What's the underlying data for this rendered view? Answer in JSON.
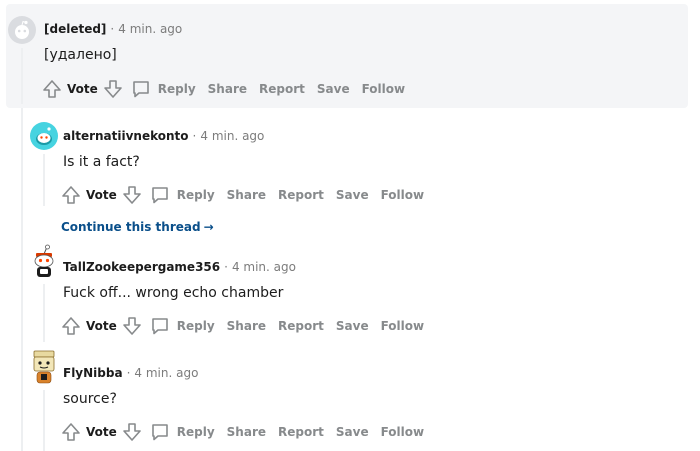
{
  "comments": [
    {
      "author": "[deleted]",
      "time": "4 min. ago",
      "body": "[удалено]",
      "actions": {
        "vote": "Vote",
        "reply": "Reply",
        "share": "Share",
        "report": "Report",
        "save": "Save",
        "follow": "Follow"
      },
      "avatar_icon": "deleted-user-avatar"
    },
    {
      "author": "alternatiivnekonto",
      "time": "4 min. ago",
      "body": "Is it a fact?",
      "actions": {
        "vote": "Vote",
        "reply": "Reply",
        "share": "Share",
        "report": "Report",
        "save": "Save",
        "follow": "Follow"
      },
      "continue": "Continue this thread",
      "avatar_icon": "snoo-avatar"
    },
    {
      "author": "TallZookeepergame356",
      "time": "4 min. ago",
      "body": "Fuck off... wrong echo chamber",
      "actions": {
        "vote": "Vote",
        "reply": "Reply",
        "share": "Share",
        "report": "Report",
        "save": "Save",
        "follow": "Follow"
      },
      "avatar_icon": "snoo-avatar"
    },
    {
      "author": "FlyNibba",
      "time": "4 min. ago",
      "body": "source?",
      "actions": {
        "vote": "Vote",
        "reply": "Reply",
        "share": "Share",
        "report": "Report",
        "save": "Save",
        "follow": "Follow"
      },
      "avatar_icon": "snoo-avatar"
    }
  ],
  "separator": "·",
  "colors": {
    "highlight_bg": "#f4f5f7",
    "action_text": "#878a8c",
    "link": "#0a4f8a",
    "meta_text": "#7c7c7c"
  }
}
